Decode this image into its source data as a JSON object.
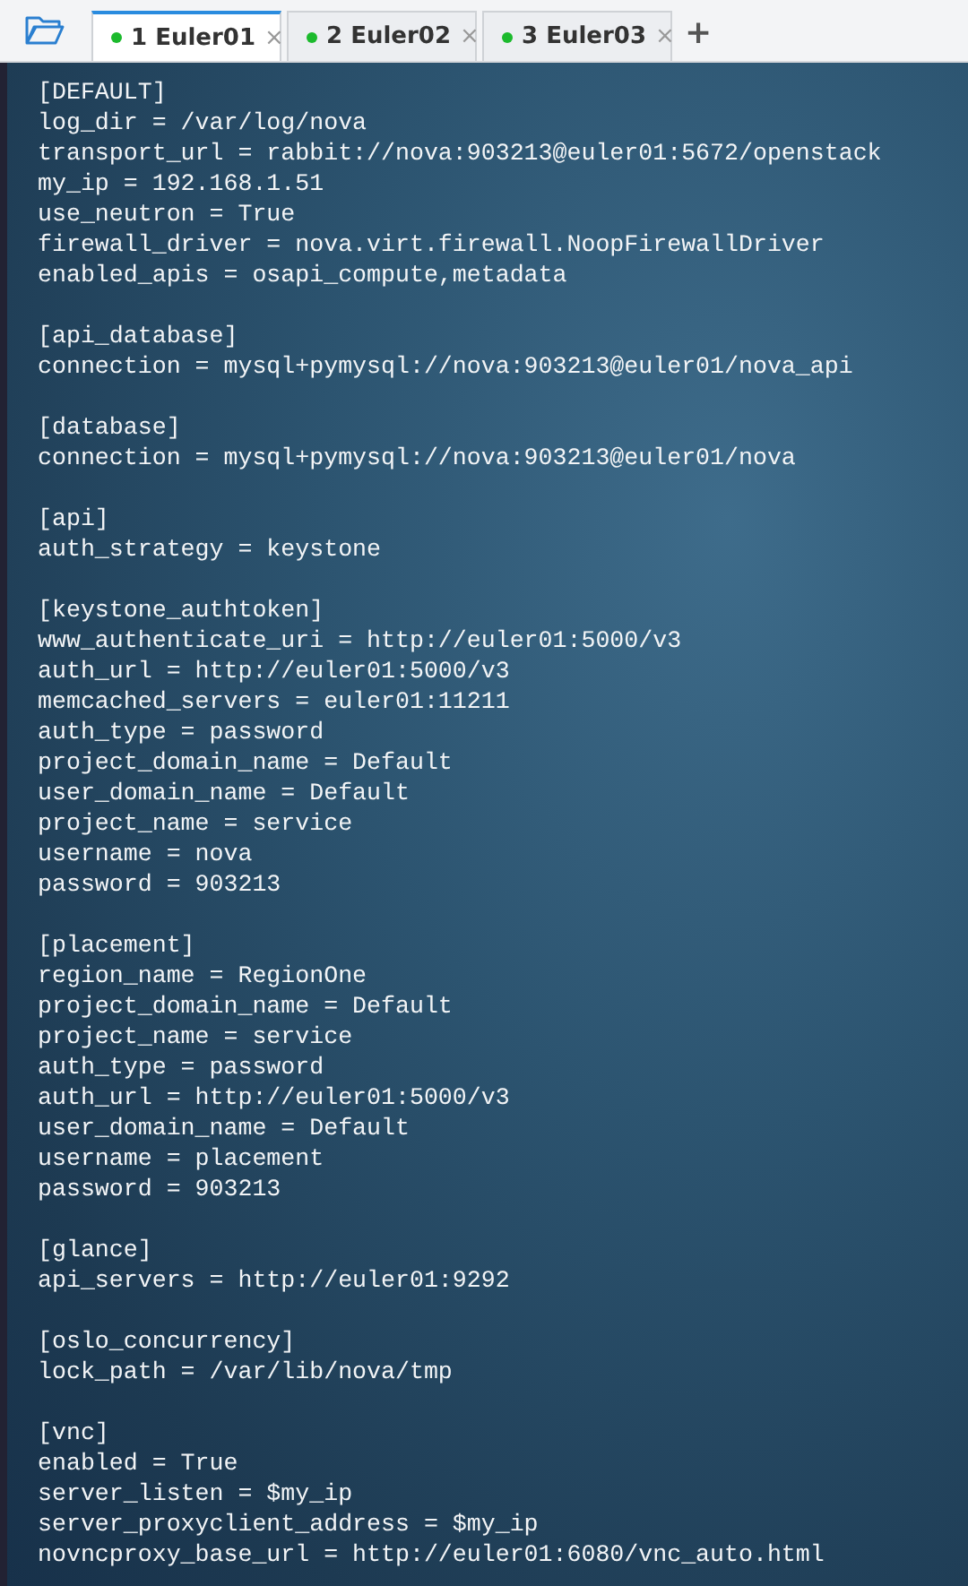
{
  "tabs": [
    {
      "number": "1",
      "label": "Euler01",
      "close": "×",
      "selected": true
    },
    {
      "number": "2",
      "label": "Euler02",
      "close": "×",
      "selected": false
    },
    {
      "number": "3",
      "label": "Euler03",
      "close": "×",
      "selected": false
    }
  ],
  "new_tab": "+",
  "terminal": {
    "sections": [
      {
        "header": "[DEFAULT]",
        "lines": [
          "log_dir = /var/log/nova",
          "transport_url = rabbit://nova:903213@euler01:5672/openstack",
          "my_ip = 192.168.1.51",
          "use_neutron = True",
          "firewall_driver = nova.virt.firewall.NoopFirewallDriver",
          "enabled_apis = osapi_compute,metadata"
        ]
      },
      {
        "header": "[api_database]",
        "lines": [
          "connection = mysql+pymysql://nova:903213@euler01/nova_api"
        ]
      },
      {
        "header": "[database]",
        "lines": [
          "connection = mysql+pymysql://nova:903213@euler01/nova"
        ]
      },
      {
        "header": "[api]",
        "lines": [
          "auth_strategy = keystone"
        ]
      },
      {
        "header": "[keystone_authtoken]",
        "lines": [
          "www_authenticate_uri = http://euler01:5000/v3",
          "auth_url = http://euler01:5000/v3",
          "memcached_servers = euler01:11211",
          "auth_type = password",
          "project_domain_name = Default",
          "user_domain_name = Default",
          "project_name = service",
          "username = nova",
          "password = 903213"
        ]
      },
      {
        "header": "[placement]",
        "lines": [
          "region_name = RegionOne",
          "project_domain_name = Default",
          "project_name = service",
          "auth_type = password",
          "auth_url = http://euler01:5000/v3",
          "user_domain_name = Default",
          "username = placement",
          "password = 903213"
        ]
      },
      {
        "header": "[glance]",
        "lines": [
          "api_servers = http://euler01:9292"
        ]
      },
      {
        "header": "[oslo_concurrency]",
        "lines": [
          "lock_path = /var/lib/nova/tmp"
        ]
      },
      {
        "header": "[vnc]",
        "lines": [
          "enabled = True",
          "server_listen = $my_ip",
          "server_proxyclient_address = $my_ip",
          "novncproxy_base_url = http://euler01:6080/vnc_auto.html"
        ]
      }
    ]
  }
}
